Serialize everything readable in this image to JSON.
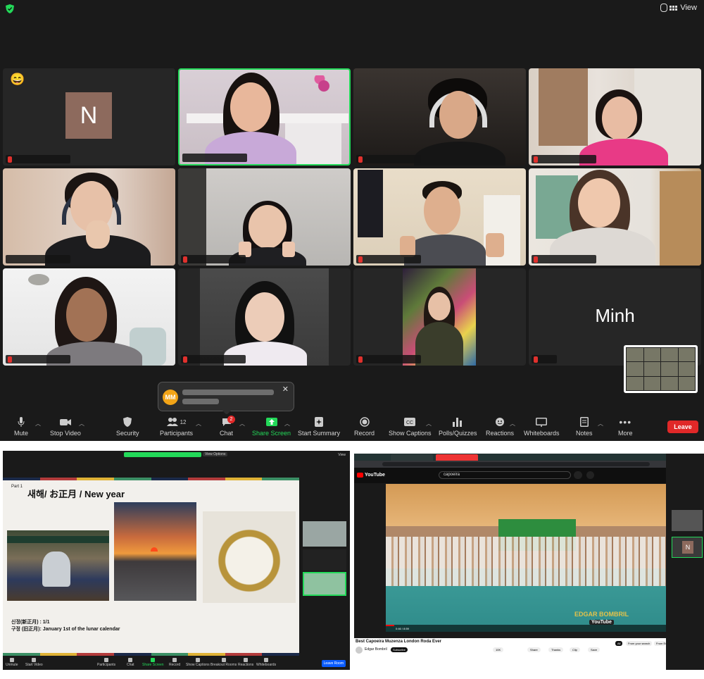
{
  "main": {
    "view_label": "View",
    "tiles": [
      {
        "id": "t1",
        "avatar_letter": "N",
        "emoji": "😄"
      },
      {
        "id": "t12",
        "display_name": "Minh"
      }
    ],
    "chat_popup": {
      "initials": "MM",
      "close": "✕"
    },
    "toolbar": {
      "mute": "Mute",
      "stop_video": "Stop Video",
      "security": "Security",
      "participants": "Participants",
      "participants_count": "12",
      "chat": "Chat",
      "chat_badge": "2",
      "share_screen": "Share Screen",
      "start_summary": "Start Summary",
      "record": "Record",
      "show_captions": "Show Captions",
      "polls": "Polls/Quizzes",
      "reactions": "Reactions",
      "whiteboards": "Whiteboards",
      "notes": "Notes",
      "more": "More",
      "leave": "Leave"
    },
    "colors": {
      "active_border": "#23d959",
      "leave": "#e02828",
      "share": "#23d959"
    }
  },
  "left": {
    "view_options": "View Options",
    "view_label": "View",
    "slide": {
      "part": "Part 1",
      "title": "새해/ お正月 / New year",
      "line1": "신정(新正月) : 1/1",
      "line2": "구정 (旧正月): January 1st of the lunar calendar"
    },
    "toolbar": {
      "unmute": "Unmute",
      "start_video": "Start Video",
      "participants": "Participants",
      "chat": "Chat",
      "share_screen": "Share Screen",
      "record": "Record",
      "show_captions": "Show Captions",
      "breakout": "Breakout Rooms",
      "reactions": "Reactions",
      "whiteboards": "Whiteboards",
      "leave_room": "Leave Room"
    }
  },
  "right": {
    "youtube_logo": "YouTube",
    "search_query": "capoeira",
    "watermark_line1": "EDGAR BOMBRIL",
    "watermark_line2": "YouTube",
    "video_title": "Best Capoeira Muzenza London Roda Ever",
    "channel": "Edgar Bombril",
    "subscribe": "Subscribe",
    "likes": "10K",
    "share": "Share",
    "thanks": "Thanks",
    "clip": "Clip",
    "save": "Save",
    "chip_all": "All",
    "chip_search": "From your search",
    "chip_channel": "From Edgar Bombril",
    "time": "0:46 / 8:59",
    "side_avatar": "N"
  }
}
